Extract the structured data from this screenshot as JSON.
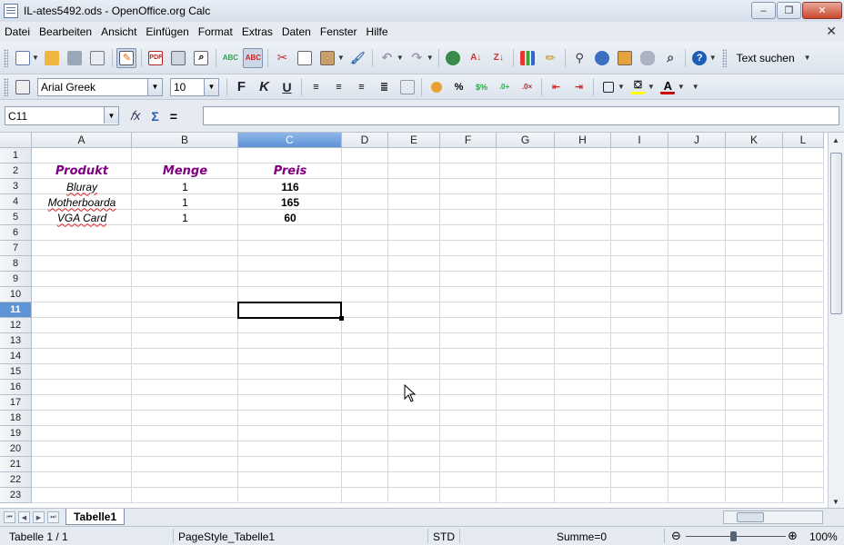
{
  "window": {
    "title": "IL-ates5492.ods - OpenOffice.org Calc",
    "minimize_label": "–",
    "maximize_label": "❐",
    "close_label": "✕"
  },
  "menu": {
    "items": [
      "Datei",
      "Bearbeiten",
      "Ansicht",
      "Einfügen",
      "Format",
      "Extras",
      "Daten",
      "Fenster",
      "Hilfe"
    ],
    "doc_close": "✕"
  },
  "toolbar": {
    "find_label": "Text suchen",
    "font_name": "Arial Greek",
    "font_size": "10"
  },
  "formula_bar": {
    "name_box": "C11",
    "function_wizard": "𝑓x",
    "sum": "Σ",
    "equals": "=",
    "input_value": ""
  },
  "sheet": {
    "columns": [
      "A",
      "B",
      "C",
      "D",
      "E",
      "F",
      "G",
      "H",
      "I",
      "J",
      "K",
      "L"
    ],
    "selected_column": "C",
    "rows": [
      "1",
      "2",
      "3",
      "4",
      "5",
      "6",
      "7",
      "8",
      "9",
      "10",
      "11",
      "12",
      "13",
      "14",
      "15",
      "16",
      "17",
      "18",
      "19",
      "20",
      "21",
      "22",
      "23"
    ],
    "selected_row": "11",
    "headers": {
      "produkt": "Produkt",
      "menge": "Menge",
      "preis": "Preis"
    },
    "data_rows": [
      {
        "produkt": "Bluray",
        "menge": "1",
        "preis": "116"
      },
      {
        "produkt": "Motherboarda",
        "menge": "1",
        "preis": "165"
      },
      {
        "produkt": "VGA Card",
        "menge": "1",
        "preis": "60"
      }
    ],
    "active_cell": "C11"
  },
  "tabs": {
    "sheet_name": "Tabelle1"
  },
  "status": {
    "sheet_pos": "Tabelle 1 / 1",
    "page_style": "PageStyle_Tabelle1",
    "mode": "STD",
    "sum": "Summe=0",
    "zoom_minus": "⊖",
    "zoom_plus": "⊕",
    "zoom": "100%"
  },
  "colors": {
    "header_text": "#800080",
    "selection": "#5e93d6"
  }
}
